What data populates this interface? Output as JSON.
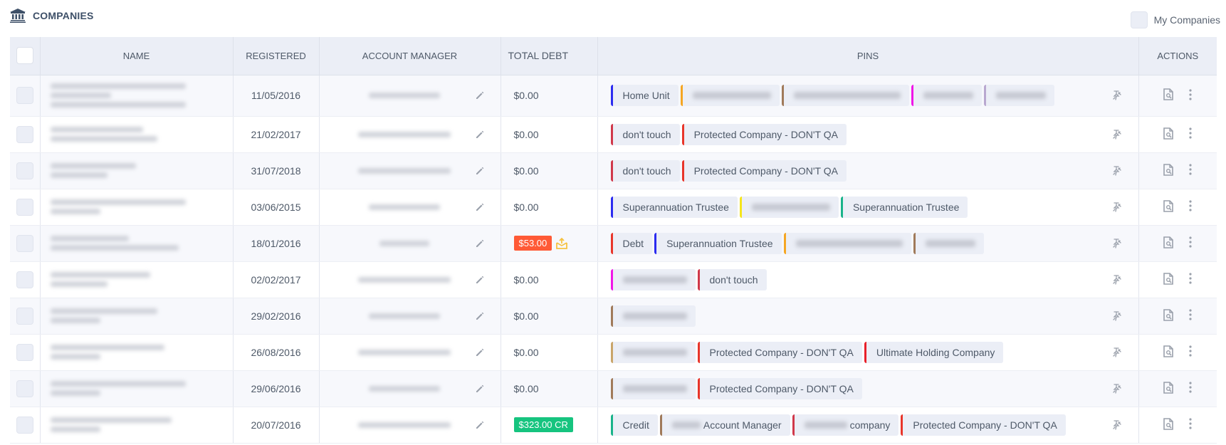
{
  "header": {
    "icon": "bank-icon",
    "title": "COMPANIES",
    "my_companies_label": "My Companies",
    "my_companies_checked": false
  },
  "table": {
    "columns": [
      "",
      "NAME",
      "REGISTERED",
      "ACCOUNT MANAGER",
      "TOTAL DEBT",
      "PINS",
      "ACTIONS"
    ],
    "rows": [
      {
        "name_lines": 3,
        "registered": "11/05/2016",
        "manager_redacted": true,
        "debt": {
          "text": "$0.00",
          "kind": "plain"
        },
        "pins": [
          {
            "label": "Home Unit",
            "color": "#2b2bf0"
          },
          {
            "label": "",
            "redacted": true,
            "color": "#f5a623"
          },
          {
            "label": "",
            "redacted": true,
            "color": "#a07a5a"
          },
          {
            "label": "",
            "redacted": true,
            "color": "#f016e8"
          },
          {
            "label": "",
            "redacted": true,
            "color": "#b9a8d0"
          }
        ]
      },
      {
        "name_lines": 2,
        "registered": "21/02/2017",
        "manager_redacted": true,
        "debt": {
          "text": "$0.00",
          "kind": "plain"
        },
        "pins": [
          {
            "label": "don't touch",
            "color": "#d0384a"
          },
          {
            "label": "Protected Company - DON'T QA",
            "color": "#e8352a"
          }
        ]
      },
      {
        "name_lines": 2,
        "registered": "31/07/2018",
        "manager_redacted": true,
        "debt": {
          "text": "$0.00",
          "kind": "plain"
        },
        "pins": [
          {
            "label": "don't touch",
            "color": "#d0384a"
          },
          {
            "label": "Protected Company - DON'T QA",
            "color": "#e8352a"
          }
        ]
      },
      {
        "name_lines": 2,
        "registered": "03/06/2015",
        "manager_redacted": true,
        "debt": {
          "text": "$0.00",
          "kind": "plain"
        },
        "pins": [
          {
            "label": "Superannuation Trustee",
            "color": "#2b2bf0"
          },
          {
            "label": "",
            "redacted": true,
            "color": "#f5e51b"
          },
          {
            "label": "Superannuation Trustee",
            "color": "#1ab38a"
          }
        ]
      },
      {
        "name_lines": 2,
        "registered": "18/01/2016",
        "manager_redacted": true,
        "debt": {
          "text": "$53.00",
          "kind": "debt",
          "color": "#ff5a36",
          "icon": "export-mail-icon",
          "icon_color": "#f5c242"
        },
        "pins": [
          {
            "label": "Debt",
            "color": "#e8352a"
          },
          {
            "label": "Superannuation Trustee",
            "color": "#2b2bf0"
          },
          {
            "label": "",
            "redacted": true,
            "color": "#f5a623"
          },
          {
            "label": "",
            "redacted": true,
            "color": "#a07a5a"
          }
        ]
      },
      {
        "name_lines": 2,
        "registered": "02/02/2017",
        "manager_redacted": true,
        "debt": {
          "text": "$0.00",
          "kind": "plain"
        },
        "pins": [
          {
            "label": "",
            "redacted": true,
            "color": "#f016e8"
          },
          {
            "label": "don't touch",
            "color": "#d0384a"
          }
        ]
      },
      {
        "name_lines": 2,
        "registered": "29/02/2016",
        "manager_redacted": true,
        "debt": {
          "text": "$0.00",
          "kind": "plain"
        },
        "pins": [
          {
            "label": "",
            "redacted": true,
            "color": "#a07a5a"
          }
        ]
      },
      {
        "name_lines": 2,
        "registered": "26/08/2016",
        "manager_redacted": true,
        "debt": {
          "text": "$0.00",
          "kind": "plain"
        },
        "pins": [
          {
            "label": "",
            "redacted": true,
            "color": "#c9a56a"
          },
          {
            "label": "Protected Company - DON'T QA",
            "color": "#e8352a"
          },
          {
            "label": "Ultimate Holding Company",
            "color": "#e8202a"
          }
        ]
      },
      {
        "name_lines": 2,
        "registered": "29/06/2016",
        "manager_redacted": true,
        "debt": {
          "text": "$0.00",
          "kind": "plain"
        },
        "pins": [
          {
            "label": "",
            "redacted": true,
            "color": "#a07a5a"
          },
          {
            "label": "Protected Company - DON'T QA",
            "color": "#e8352a"
          }
        ]
      },
      {
        "name_lines": 2,
        "registered": "20/07/2016",
        "manager_redacted": true,
        "debt": {
          "text": "$323.00 CR",
          "kind": "credit",
          "color": "#16c47f"
        },
        "pins": [
          {
            "label": "Credit",
            "color": "#1ab38a"
          },
          {
            "label": "Account Manager",
            "prefix_redacted": true,
            "color": "#a07a5a"
          },
          {
            "label": "company",
            "prefix_redacted": true,
            "color": "#d0384a"
          },
          {
            "label": "Protected Company - DON'T QA",
            "color": "#e8352a"
          }
        ]
      }
    ],
    "row_icons": {
      "edit": "pencil-icon",
      "pin": "pin-icon",
      "view": "document-search-icon",
      "more": "more-vertical-icon"
    }
  }
}
